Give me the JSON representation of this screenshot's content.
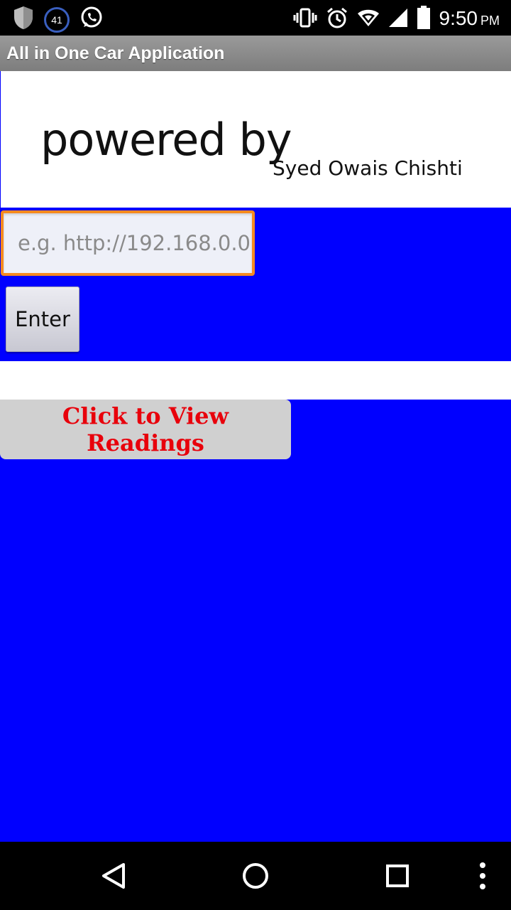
{
  "status_bar": {
    "notification_count": "41",
    "time": "9:50",
    "ampm": "PM"
  },
  "app": {
    "title": "All in One Car Application"
  },
  "banner": {
    "powered_by": "powered by",
    "author": "Syed Owais Chishti"
  },
  "form": {
    "url_placeholder": "e.g. http://192.168.0.0",
    "url_value": "",
    "enter_label": "Enter"
  },
  "actions": {
    "view_readings_label": "Click to View Readings"
  },
  "colors": {
    "background": "#0000ff",
    "input_focus_border": "#f58a1f",
    "readings_text": "#e8000b"
  }
}
